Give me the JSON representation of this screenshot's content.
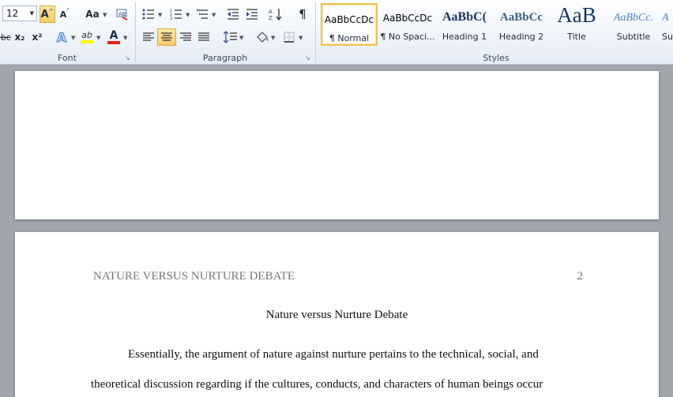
{
  "ribbon": {
    "font": {
      "label": "Font",
      "font_size": "12",
      "grow_font": "A",
      "change_case": "Aa",
      "subscript": "x₂",
      "superscript": "x²",
      "strikethrough": "abc",
      "font_color_glyph": "A",
      "text_effects_glyph": "A",
      "highlight_glyph": "ab"
    },
    "paragraph": {
      "label": "Paragraph",
      "pilcrow": "¶"
    },
    "styles": {
      "label": "Styles",
      "items": [
        {
          "preview": "AaBbCcDc",
          "name": "¶ Normal"
        },
        {
          "preview": "AaBbCcDc",
          "name": "¶ No Spaci..."
        },
        {
          "preview": "AaBbC(",
          "name": "Heading 1"
        },
        {
          "preview": "AaBbCc",
          "name": "Heading 2"
        },
        {
          "preview": "AaB",
          "name": "Title"
        },
        {
          "preview": "AaBbCc.",
          "name": "Subtitle"
        },
        {
          "preview": "A",
          "name": "Su"
        }
      ]
    }
  },
  "document": {
    "header_title": "NATURE VERSUS NURTURE DEBATE",
    "page_number": "2",
    "title": "Nature versus Nurture Debate",
    "line1": "Essentially, the argument of nature against nurture pertains to the technical, social, and",
    "line2": "theoretical discussion regarding if the cultures, conducts, and characters of human beings occur"
  },
  "colors": {
    "accent_active": "#f8cd6a",
    "font_color_bar": "#e0241c",
    "highlight_bar": "#ffff00",
    "heading_blue": "#365f91",
    "workspace": "#a0a5ae"
  }
}
